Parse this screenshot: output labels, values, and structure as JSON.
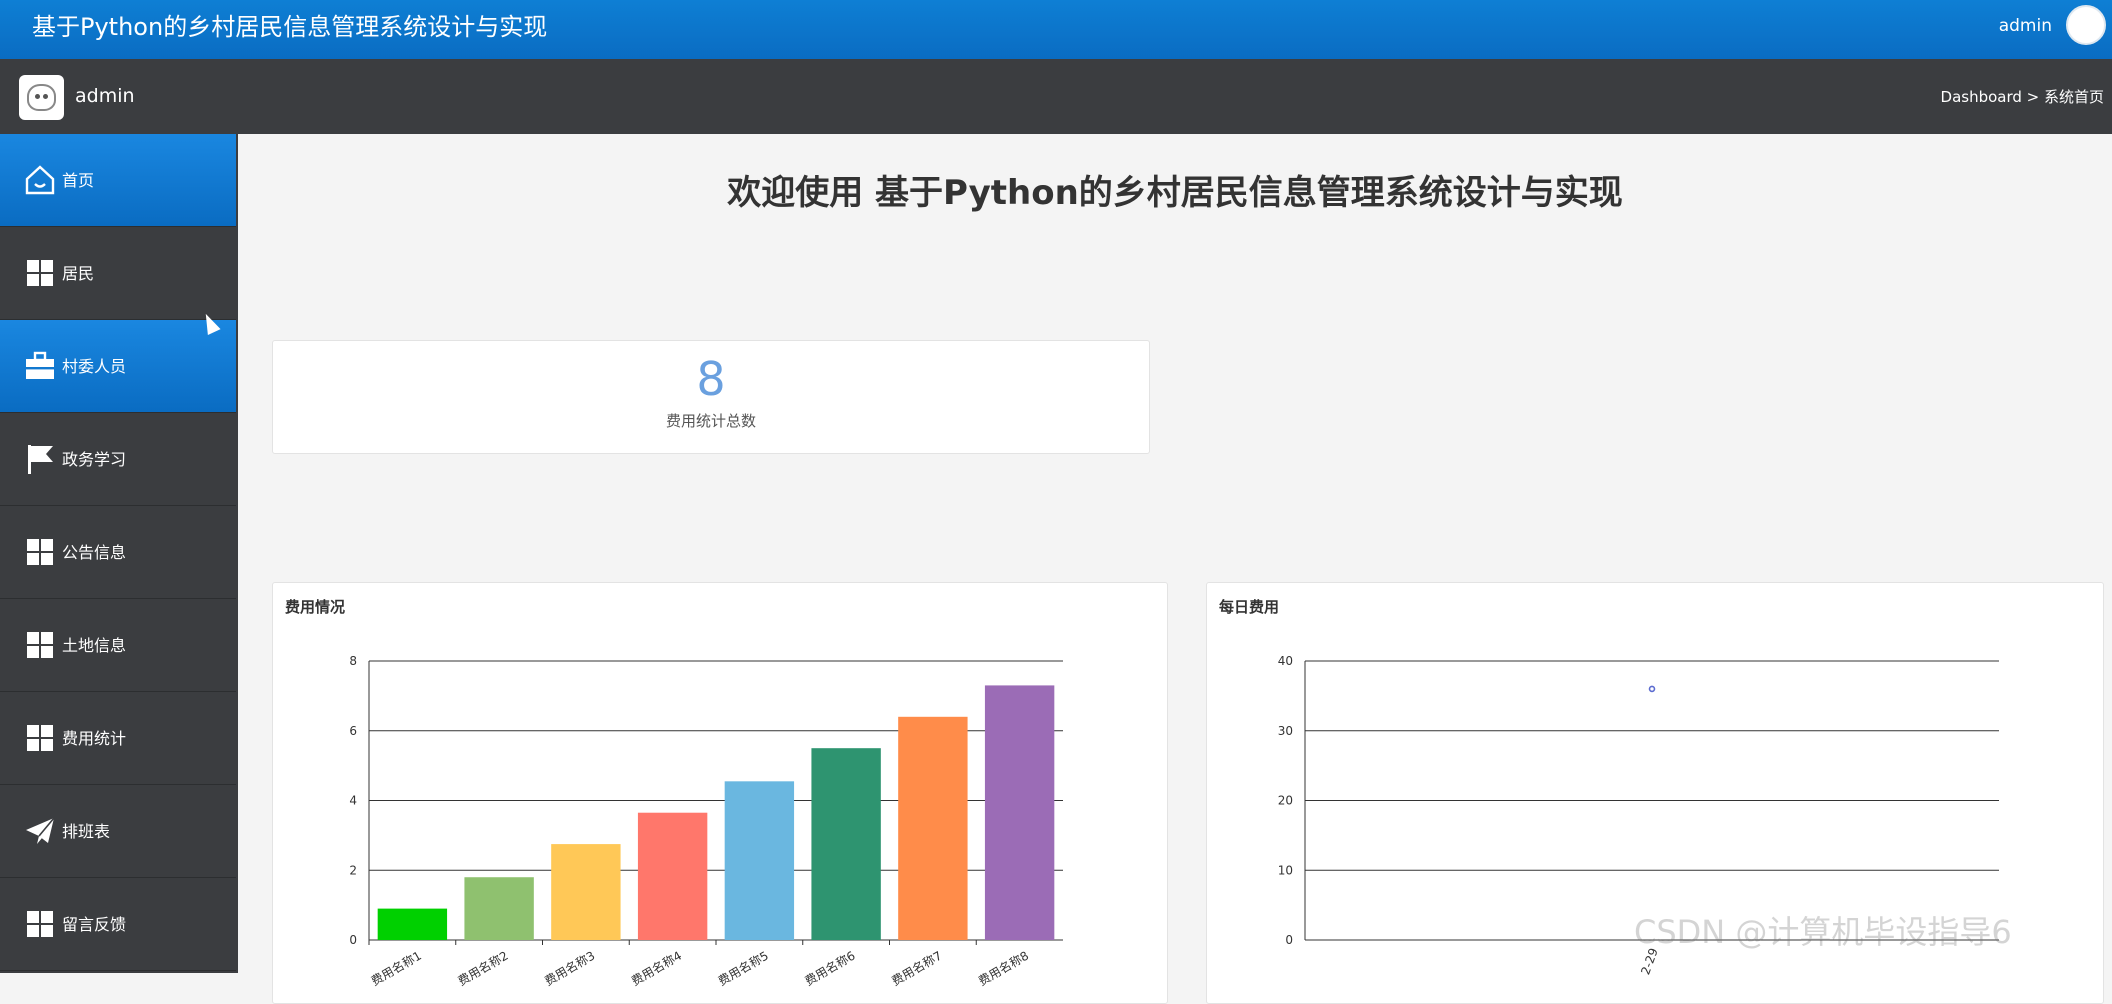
{
  "header": {
    "title": "基于Python的乡村居民信息管理系统设计与实现",
    "user": "admin"
  },
  "subheader": {
    "username": "admin",
    "breadcrumb": "Dashboard > 系统首页"
  },
  "sidebar": {
    "items": [
      {
        "label": "首页",
        "icon": "home-icon",
        "active": true
      },
      {
        "label": "居民",
        "icon": "grid-icon",
        "active": false
      },
      {
        "label": "村委人员",
        "icon": "briefcase-icon",
        "active": true
      },
      {
        "label": "政务学习",
        "icon": "flag-icon",
        "active": false
      },
      {
        "label": "公告信息",
        "icon": "grid-icon",
        "active": false
      },
      {
        "label": "土地信息",
        "icon": "grid-icon",
        "active": false
      },
      {
        "label": "费用统计",
        "icon": "grid-icon",
        "active": false
      },
      {
        "label": "排班表",
        "icon": "paper-plane-icon",
        "active": false
      },
      {
        "label": "留言反馈",
        "icon": "grid-icon",
        "active": false
      }
    ]
  },
  "main": {
    "welcome": "欢迎使用 基于Python的乡村居民信息管理系统设计与实现",
    "stat": {
      "value": "8",
      "caption": "费用统计总数"
    }
  },
  "chart_data": [
    {
      "type": "bar",
      "title": "费用情况",
      "categories": [
        "费用名称1",
        "费用名称2",
        "费用名称3",
        "费用名称4",
        "费用名称5",
        "费用名称6",
        "费用名称7",
        "费用名称8"
      ],
      "values": [
        0.9,
        1.8,
        2.75,
        3.65,
        4.55,
        5.5,
        6.4,
        7.3
      ],
      "colors": [
        "#00d000",
        "#8fc16f",
        "#ffc857",
        "#ff776b",
        "#6ab7e0",
        "#2e9470",
        "#ff8c4a",
        "#9b6cb6"
      ],
      "ylim": [
        0,
        8
      ],
      "yticks": [
        0,
        2,
        4,
        6,
        8
      ],
      "grid": true
    },
    {
      "type": "scatter",
      "title": "每日费用",
      "x": [
        "2-29"
      ],
      "values": [
        36
      ],
      "ylim": [
        0,
        40
      ],
      "yticks": [
        0,
        10,
        20,
        30,
        40
      ],
      "grid": true
    }
  ],
  "watermark": "CSDN @计算机毕设指导6"
}
